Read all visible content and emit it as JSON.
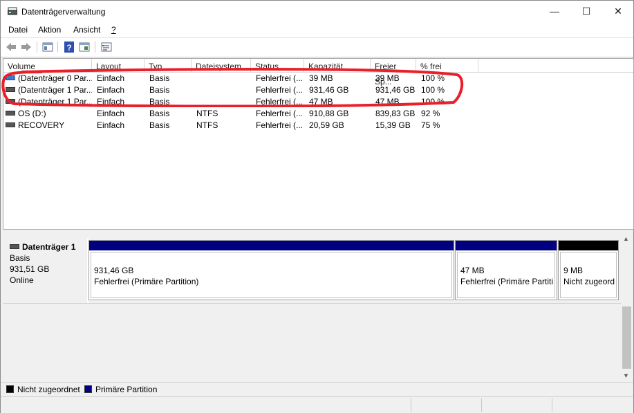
{
  "window": {
    "title": "Datenträgerverwaltung",
    "minimize": "—",
    "maximize": "☐",
    "close": "✕"
  },
  "menu": [
    {
      "label": "Datei",
      "accel": "D"
    },
    {
      "label": "Aktion",
      "accel": "k"
    },
    {
      "label": "Ansicht",
      "accel": "A"
    },
    {
      "label": "?",
      "accel": "?"
    }
  ],
  "toolbar": {
    "icons": [
      "back-arrow-icon",
      "forward-arrow-icon",
      "console-tree-icon",
      "help-icon",
      "view-icon",
      "properties-icon"
    ]
  },
  "volume_list": {
    "columns": [
      "Volume",
      "Layout",
      "Typ",
      "Dateisystem",
      "Status",
      "Kapazität",
      "Freier Sp...",
      "% frei"
    ],
    "rows": [
      {
        "volume": "(Datenträger 0 Par...",
        "layout": "Einfach",
        "typ": "Basis",
        "fs": "",
        "status": "Fehlerfrei (...",
        "kap": "39 MB",
        "frei": "39 MB",
        "pct": "100 %",
        "icon": "system-disk-icon"
      },
      {
        "volume": "(Datenträger 1 Par...",
        "layout": "Einfach",
        "typ": "Basis",
        "fs": "",
        "status": "Fehlerfrei (...",
        "kap": "931,46 GB",
        "frei": "931,46 GB",
        "pct": "100 %",
        "icon": "disk-icon"
      },
      {
        "volume": "(Datenträger 1 Par...",
        "layout": "Einfach",
        "typ": "Basis",
        "fs": "",
        "status": "Fehlerfrei (...",
        "kap": "47 MB",
        "frei": "47 MB",
        "pct": "100 %",
        "icon": "disk-icon"
      },
      {
        "volume": "OS (D:)",
        "layout": "Einfach",
        "typ": "Basis",
        "fs": "NTFS",
        "status": "Fehlerfrei (...",
        "kap": "910,88 GB",
        "frei": "839,83 GB",
        "pct": "92 %",
        "icon": "disk-icon"
      },
      {
        "volume": "RECOVERY",
        "layout": "Einfach",
        "typ": "Basis",
        "fs": "NTFS",
        "status": "Fehlerfrei (...",
        "kap": "20,59 GB",
        "frei": "15,39 GB",
        "pct": "75 %",
        "icon": "disk-icon"
      }
    ]
  },
  "disk_graph": {
    "disk": {
      "name": "Datenträger 1",
      "type": "Basis",
      "size": "931,51 GB",
      "state": "Online"
    },
    "partitions": [
      {
        "size": "931,46 GB",
        "status": "Fehlerfrei (Primäre Partition)",
        "color": "#000080"
      },
      {
        "size": "47 MB",
        "status": "Fehlerfrei (Primäre Partitio",
        "color": "#000080"
      },
      {
        "size": "9 MB",
        "status": "Nicht zugeord",
        "color": "#000000"
      }
    ]
  },
  "legend": {
    "items": [
      {
        "label": "Nicht zugeordnet",
        "color": "#000000"
      },
      {
        "label": "Primäre Partition",
        "color": "#000080"
      }
    ]
  },
  "annotation": {
    "color": "#e8202a"
  }
}
